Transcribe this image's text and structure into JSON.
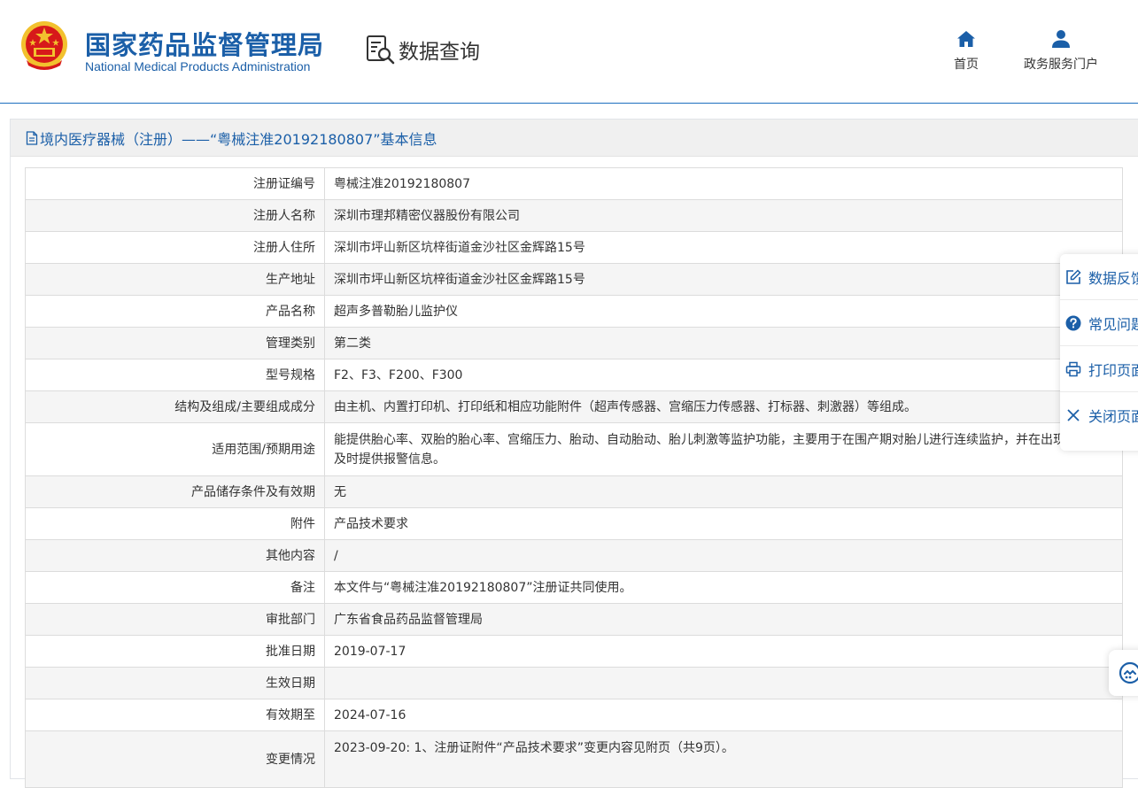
{
  "header": {
    "logo_cn": "国家药品监督管理局",
    "logo_en": "National Medical Products Administration",
    "section_title": "数据查询",
    "nav": [
      {
        "label": "首页",
        "icon": "home-icon"
      },
      {
        "label": "政务服务门户",
        "icon": "user-icon"
      }
    ]
  },
  "panel": {
    "title": "境内医疗器械（注册）——“粤械注准20192180807”基本信息"
  },
  "rows": [
    {
      "label": "注册证编号",
      "value": "粤械注准20192180807"
    },
    {
      "label": "注册人名称",
      "value": "深圳市理邦精密仪器股份有限公司"
    },
    {
      "label": "注册人住所",
      "value": "深圳市坪山新区坑梓街道金沙社区金辉路15号"
    },
    {
      "label": "生产地址",
      "value": "深圳市坪山新区坑梓街道金沙社区金辉路15号"
    },
    {
      "label": "产品名称",
      "value": "超声多普勒胎儿监护仪"
    },
    {
      "label": "管理类别",
      "value": "第二类"
    },
    {
      "label": "型号规格",
      "value": "F2、F3、F200、F300"
    },
    {
      "label": "结构及组成/主要组成成分",
      "value": "由主机、内置打印机、打印纸和相应功能附件（超声传感器、宫缩压力传感器、打标器、刺激器）等组成。"
    },
    {
      "label": "适用范围/预期用途",
      "value": "能提供胎心率、双胎的胎心率、宫缩压力、胎动、自动胎动、胎儿刺激等监护功能，主要用于在围产期对胎儿进行连续监护，并在出现异常时及时提供报警信息。"
    },
    {
      "label": "产品储存条件及有效期",
      "value": "无"
    },
    {
      "label": "附件",
      "value": "产品技术要求"
    },
    {
      "label": "其他内容",
      "value": "/"
    },
    {
      "label": "备注",
      "value": "本文件与“粤械注准20192180807”注册证共同使用。"
    },
    {
      "label": "审批部门",
      "value": "广东省食品药品监督管理局"
    },
    {
      "label": "批准日期",
      "value": "2019-07-17"
    },
    {
      "label": "生效日期",
      "value": ""
    },
    {
      "label": "有效期至",
      "value": "2024-07-16"
    },
    {
      "label": "变更情况",
      "value": "2023-09-20: 1、注册证附件“产品技术要求”变更内容见附页（共9页）。"
    }
  ],
  "sidebar": {
    "items": [
      {
        "label": "数据反馈",
        "icon": "edit-icon"
      },
      {
        "label": "常见问题",
        "icon": "help-icon"
      },
      {
        "label": "打印页面",
        "icon": "printer-icon"
      },
      {
        "label": "关闭页面",
        "icon": "close-icon"
      }
    ]
  },
  "colors": {
    "brand_blue": "#1b5fa8",
    "emblem_red": "#d7191a",
    "emblem_gold": "#f2c12e"
  }
}
